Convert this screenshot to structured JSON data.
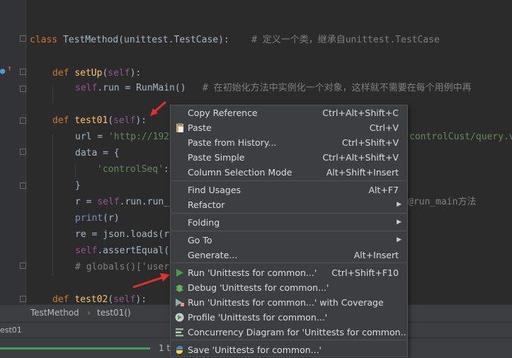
{
  "editor": {
    "lines": [
      {
        "parts": [
          [
            "kw",
            "class "
          ],
          [
            "",
            "TestMethod(unittest.TestCase):    "
          ],
          [
            "cmt",
            "# 定义一个类，继承自unittest.TestCase"
          ]
        ]
      },
      {
        "parts": [
          [
            "kw",
            "def "
          ],
          [
            "fn",
            "setUp"
          ],
          [
            "",
            "("
          ],
          [
            "slf",
            "self"
          ],
          [
            "",
            "):"
          ]
        ]
      },
      {
        "parts": [
          [
            "slf",
            "self"
          ],
          [
            "",
            ".run = RunMain()   "
          ],
          [
            "cmt",
            "# 在初始化方法中实例化一个对象，这样就不需要在每个用例中再"
          ]
        ]
      },
      {
        "parts": [
          [
            "kw",
            "def "
          ],
          [
            "fn",
            "test01"
          ],
          [
            "",
            "("
          ],
          [
            "slf",
            "self"
          ],
          [
            "",
            "):"
          ]
        ]
      },
      {
        "parts": [
          [
            "",
            "url = "
          ],
          [
            "str",
            "'http://192"
          ]
        ]
      },
      {
        "parts": [
          [
            "",
            "data = {"
          ]
        ]
      },
      {
        "parts": [
          [
            "str",
            "'controlSeq'"
          ],
          [
            "",
            ":"
          ]
        ]
      },
      {
        "parts": [
          [
            "",
            "}"
          ]
        ]
      },
      {
        "parts": [
          [
            "",
            "r = "
          ],
          [
            "slf",
            "self"
          ],
          [
            "",
            ".run.run_"
          ]
        ]
      },
      {
        "parts": [
          [
            "bi",
            "print"
          ],
          [
            "",
            "(r)"
          ]
        ]
      },
      {
        "parts": [
          [
            "",
            "re = json.loads(r"
          ]
        ]
      },
      {
        "parts": [
          [
            "slf",
            "self"
          ],
          [
            "",
            ".assertEqual("
          ]
        ]
      },
      {
        "parts": [
          [
            "cmt",
            "# globals()['user"
          ]
        ]
      },
      {
        "parts": [
          [
            "kw",
            "def "
          ],
          [
            "fn",
            "test02"
          ],
          [
            "",
            "("
          ],
          [
            "slf",
            "self"
          ],
          [
            "",
            "):"
          ]
        ]
      }
    ],
    "right_fragments": [
      {
        "text": "controlCust/query.v",
        "cls": "str"
      },
      {
        "text": "@run_main方法",
        "cls": "cmt"
      }
    ]
  },
  "breadcrumb": {
    "class_name": "TestMethod",
    "separator": "›",
    "method_name": "test01()"
  },
  "run_panel": {
    "tab_label": "est01",
    "progress_fraction": 1.0,
    "count_text": "1 t"
  },
  "context_menu": {
    "items": [
      {
        "label": "Copy Reference",
        "shortcut": "Ctrl+Alt+Shift+C"
      },
      {
        "label": "Paste",
        "shortcut": "Ctrl+V",
        "icon": "paste-icon"
      },
      {
        "label": "Paste from History...",
        "shortcut": "Ctrl+Shift+V"
      },
      {
        "label": "Paste Simple",
        "shortcut": "Ctrl+Alt+Shift+V"
      },
      {
        "label": "Column Selection Mode",
        "shortcut": "Alt+Shift+Insert"
      },
      {
        "label": "Find Usages",
        "shortcut": "Alt+F7"
      },
      {
        "label": "Refactor",
        "submenu": true
      },
      {
        "label": "Folding",
        "submenu": true
      },
      {
        "label": "Go To",
        "submenu": true
      },
      {
        "label": "Generate...",
        "shortcut": "Alt+Insert"
      },
      {
        "label": "Run 'Unittests for common...'",
        "shortcut": "Ctrl+Shift+F10",
        "icon": "run-icon"
      },
      {
        "label": "Debug 'Unittests for common...'",
        "icon": "debug-icon"
      },
      {
        "label": "Run 'Unittests for common...' with Coverage",
        "icon": "coverage-icon"
      },
      {
        "label": "Profile 'Unittests for common...'",
        "icon": "profile-icon"
      },
      {
        "label": "Concurrency Diagram for 'Unittests for common...'",
        "icon": "concurrency-icon"
      },
      {
        "label": "Save 'Unittests for common...'",
        "icon": "python-icon"
      }
    ]
  },
  "colors": {
    "accent_run": "#499c54",
    "annotation_arrow": "#e0322a"
  }
}
